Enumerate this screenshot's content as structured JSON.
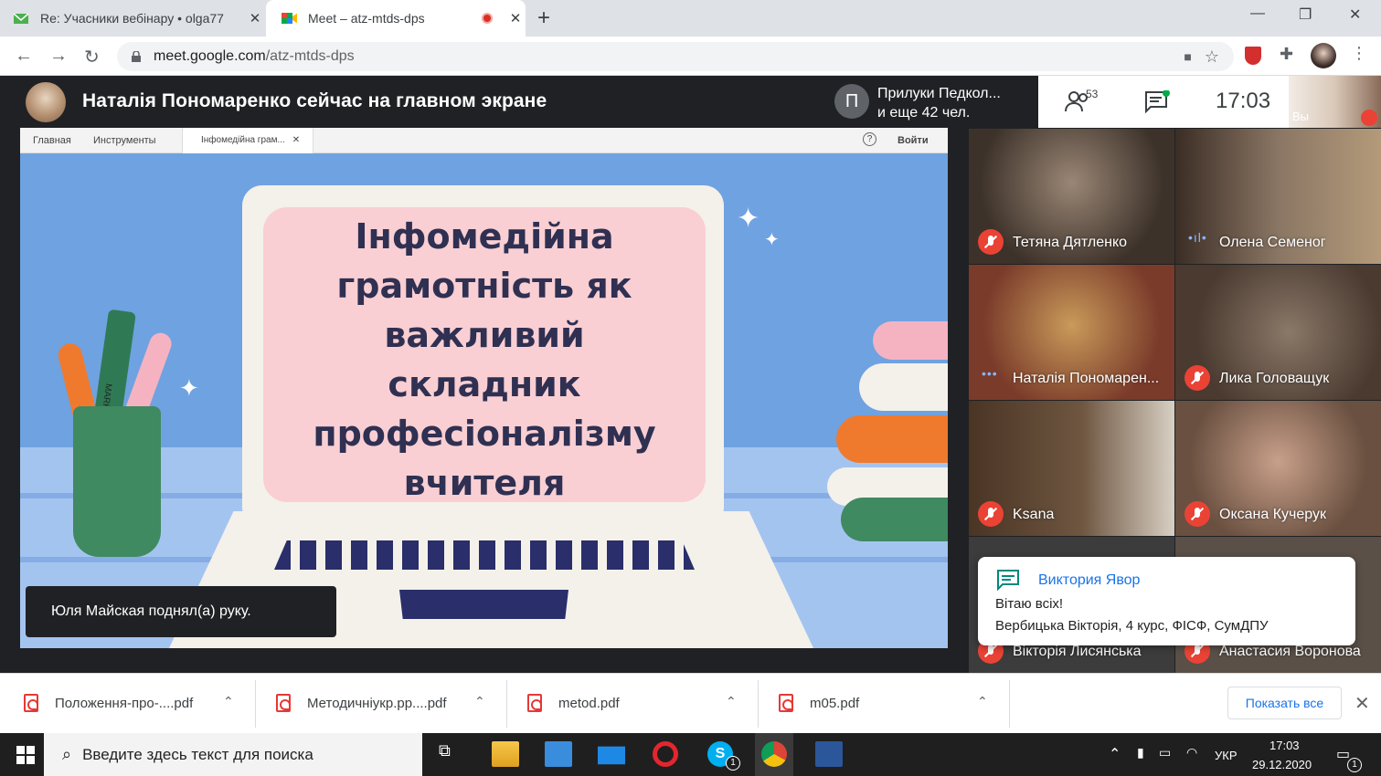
{
  "browser": {
    "tabs": [
      {
        "title": "Re: Учасники вебінару • olga77",
        "close": "✕"
      },
      {
        "title": "Meet – atz-mtds-dps",
        "close": "✕"
      }
    ],
    "new_tab": "+",
    "window_controls": {
      "minimize": "—",
      "maximize": "❐",
      "close": "✕"
    },
    "url_host": "meet.google.com",
    "url_path": "/atz-mtds-dps"
  },
  "meet": {
    "presenter_banner": "Наталія Пономаренко сейчас на главном экране",
    "pinned": {
      "initial": "П",
      "line1": "Прилуки Педкол...",
      "line2": "и еще 42 чел."
    },
    "participants_count": "53",
    "time": "17:03",
    "self_label": "Вы",
    "ppt_tabs": [
      "Главная",
      "Инструменты",
      "Інфомедійна грам...",
      "✕"
    ],
    "ppt_help": "?",
    "ppt_login": "Войти",
    "slide_title": "Інфомедійна\nграмотність як\nважливий\nскладник\nпрофесіоналізму\nвчителя",
    "pen_label": "MARK",
    "hand_raised": "Юля Майская поднял(а) руку.",
    "tiles": [
      {
        "name": "Тетяна Дятленко",
        "status": "muted"
      },
      {
        "name": "Олена Семеног",
        "status": "speaking"
      },
      {
        "name": "Наталія Пономарен...",
        "status": "active"
      },
      {
        "name": "Лика Головащук",
        "status": "muted"
      },
      {
        "name": "Ksana",
        "status": "muted"
      },
      {
        "name": "Оксана Кучерук",
        "status": "muted"
      },
      {
        "name": "Вікторія Лисянська",
        "status": "muted"
      },
      {
        "name": "Анастасия Воронова",
        "status": "muted"
      }
    ],
    "speaking_dots": "•ıl•",
    "active_dots": "•••",
    "chat": {
      "sender": "Виктория Явор",
      "line1": "Вітаю всіх!",
      "line2": "Вербицька Вікторія,  4 курс, ФІСФ, СумДПУ"
    }
  },
  "downloads": {
    "files": [
      "Положення-про-....pdf",
      "Методичніукр.pp....pdf",
      "metod.pdf",
      "m05.pdf"
    ],
    "chevron": "⌃",
    "show_all": "Показать все",
    "close": "✕"
  },
  "taskbar": {
    "search_placeholder": "Введите здесь текст для поиска",
    "lang": "УКР",
    "time": "17:03",
    "date": "29.12.2020",
    "skype_badge": "1",
    "notif_badge": "1"
  },
  "colors": {
    "accent": "#1a73e8",
    "muted": "#ea4335",
    "slide_bg": "#6fa2e0",
    "slide_pink": "#f9cfd3"
  }
}
